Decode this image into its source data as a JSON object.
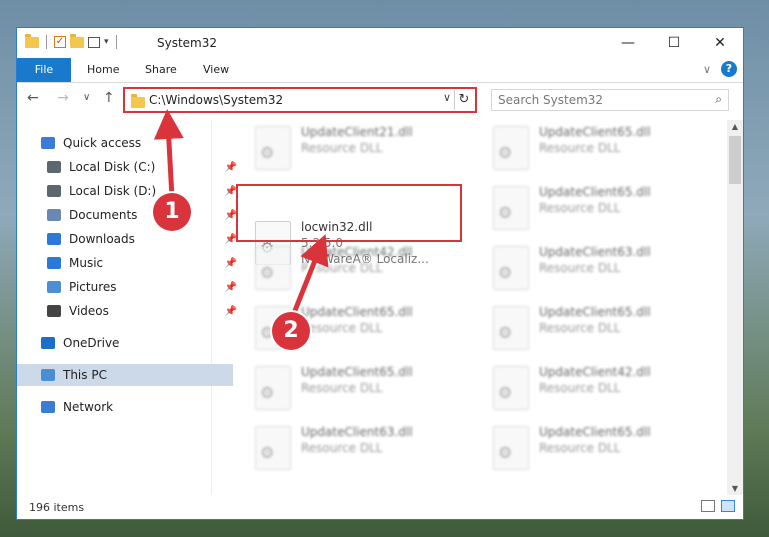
{
  "window": {
    "title": "System32",
    "controls": {
      "minimize": "—",
      "maximize": "☐",
      "close": "✕"
    }
  },
  "ribbon": {
    "tabs": [
      "File",
      "Home",
      "Share",
      "View"
    ],
    "expand_chevron": "∨",
    "help": "?"
  },
  "address": {
    "path": "C:\\Windows\\System32",
    "dropdown": "∨",
    "refresh": "↻"
  },
  "search": {
    "placeholder": "Search System32"
  },
  "nav": {
    "back": "←",
    "forward": "→",
    "recent": "∨",
    "up": "↑",
    "items": [
      {
        "label": "Quick access",
        "icon": "star-icon",
        "color": "#3a7bd5",
        "pinned": false
      },
      {
        "label": "Local Disk (C:)",
        "icon": "drive-icon",
        "color": "#5c6770",
        "pinned": true
      },
      {
        "label": "Local Disk (D:)",
        "icon": "drive-icon",
        "color": "#5c6770",
        "pinned": true
      },
      {
        "label": "Documents",
        "icon": "documents-icon",
        "color": "#6a88b4",
        "pinned": true
      },
      {
        "label": "Downloads",
        "icon": "download-icon",
        "color": "#2c7ad6",
        "pinned": true
      },
      {
        "label": "Music",
        "icon": "music-icon",
        "color": "#2c7ad6",
        "pinned": true
      },
      {
        "label": "Pictures",
        "icon": "pictures-icon",
        "color": "#4d8fd4",
        "pinned": true
      },
      {
        "label": "Videos",
        "icon": "videos-icon",
        "color": "#444444",
        "pinned": true
      },
      {
        "label": "OneDrive",
        "icon": "cloud-icon",
        "color": "#1c6fc9",
        "pinned": false
      },
      {
        "label": "This PC",
        "icon": "computer-icon",
        "color": "#4a8fd6",
        "pinned": false
      },
      {
        "label": "Network",
        "icon": "network-icon",
        "color": "#3a7bd5",
        "pinned": false
      }
    ],
    "pin_glyph": "📌"
  },
  "files": {
    "highlighted": {
      "name": "locwin32.dll",
      "version": "5.2.5.0",
      "description": "NetWareA® Localiz..."
    },
    "blurred": [
      {
        "name": "UpdateClient21.dll",
        "type": "Resource DLL"
      },
      {
        "name": "UpdateClient65.dll",
        "type": "Resource DLL"
      },
      {
        "name": "UpdateClient65.dll",
        "type": "Resource DLL"
      },
      {
        "name": "UpdateClient42.dll",
        "type": "Resource DLL"
      },
      {
        "name": "UpdateClient63.dll",
        "type": "Resource DLL"
      },
      {
        "name": "UpdateClient65.dll",
        "type": "Resource DLL"
      },
      {
        "name": "UpdateClient65.dll",
        "type": "Resource DLL"
      },
      {
        "name": "UpdateClient65.dll",
        "type": "Resource DLL"
      },
      {
        "name": "UpdateClient42.dll",
        "type": "Resource DLL"
      },
      {
        "name": "UpdateClient63.dll",
        "type": "Resource DLL"
      },
      {
        "name": "UpdateClient65.dll",
        "type": "Resource DLL"
      }
    ]
  },
  "status": {
    "item_count": "196 items"
  },
  "annotations": {
    "step1": "1",
    "step2": "2",
    "accent": "#d9343b"
  }
}
